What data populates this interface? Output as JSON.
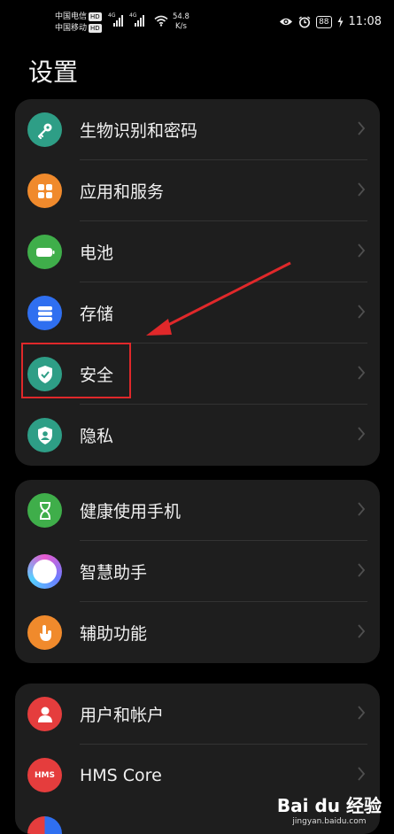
{
  "status_bar": {
    "carrier1": "中国电信",
    "carrier2": "中国移动",
    "hd": "HD",
    "network1": "4G",
    "network2": "4G",
    "speed_value": "54.8",
    "speed_unit": "K/s",
    "battery": "88",
    "time": "11:08"
  },
  "page_title": "设置",
  "groups": [
    {
      "items": [
        {
          "label": "生物识别和密码",
          "icon": "key-icon",
          "color": "#2e9e86"
        },
        {
          "label": "应用和服务",
          "icon": "apps-icon",
          "color": "#f08a2c"
        },
        {
          "label": "电池",
          "icon": "battery-icon",
          "color": "#3fae4a"
        },
        {
          "label": "存储",
          "icon": "storage-icon",
          "color": "#2f6ff0"
        },
        {
          "label": "安全",
          "icon": "shield-icon",
          "color": "#2e9e86"
        },
        {
          "label": "隐私",
          "icon": "privacy-icon",
          "color": "#2e9e86"
        }
      ]
    },
    {
      "items": [
        {
          "label": "健康使用手机",
          "icon": "hourglass-icon",
          "color": "#3fae4a"
        },
        {
          "label": "智慧助手",
          "icon": "assistant-icon",
          "color": "#e85ad0"
        },
        {
          "label": "辅助功能",
          "icon": "hand-icon",
          "color": "#f08a2c"
        }
      ]
    },
    {
      "items": [
        {
          "label": "用户和帐户",
          "icon": "user-icon",
          "color": "#e53d3d"
        },
        {
          "label": "HMS Core",
          "icon": "hms-icon",
          "color": "#e53d3d",
          "icon_text": "HMS"
        }
      ]
    }
  ],
  "watermark": {
    "main": "Bai du 经验",
    "sub": "jingyan.baidu.com"
  },
  "colors": {
    "background": "#000000",
    "card": "#1e1e1e",
    "highlight": "#e0282a"
  }
}
